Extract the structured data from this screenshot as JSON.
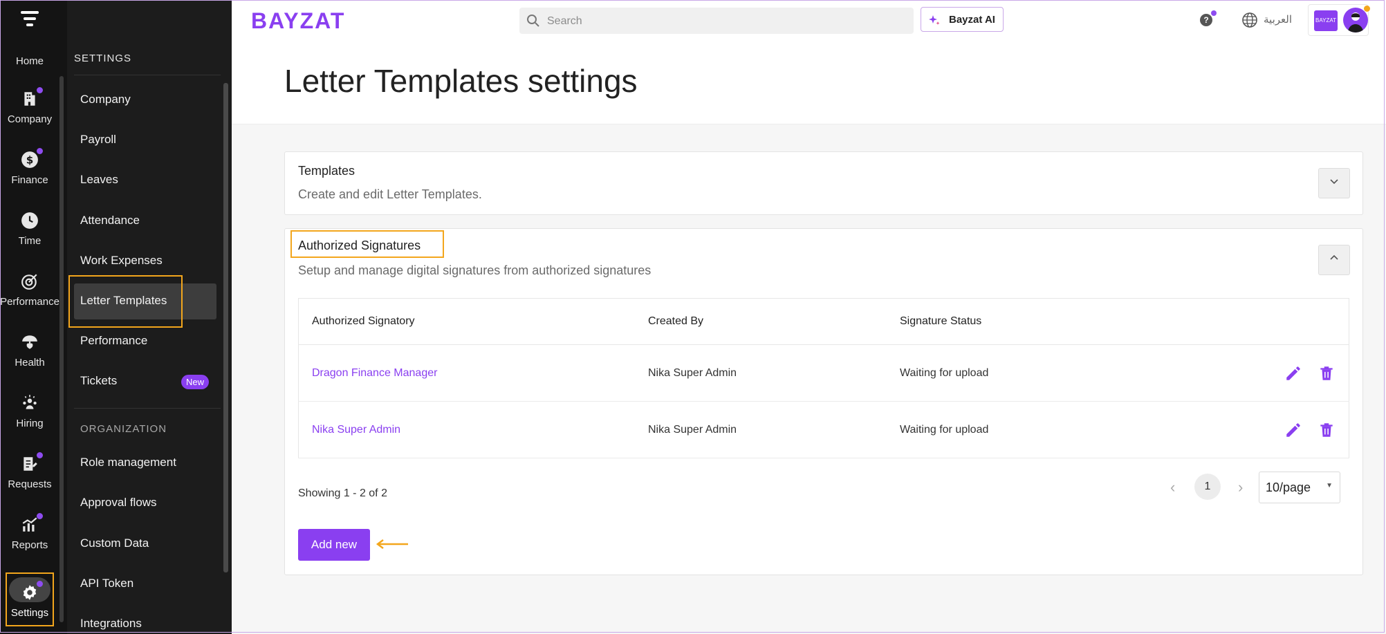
{
  "rail": {
    "items": [
      {
        "label": "Home",
        "icon": "home-icon"
      },
      {
        "label": "Company",
        "icon": "building-icon"
      },
      {
        "label": "Finance",
        "icon": "dollar-icon"
      },
      {
        "label": "Time",
        "icon": "clock-icon"
      },
      {
        "label": "Performance",
        "icon": "target-icon"
      },
      {
        "label": "Health",
        "icon": "umbrella-heart-icon"
      },
      {
        "label": "Hiring",
        "icon": "people-icon"
      },
      {
        "label": "Requests",
        "icon": "request-doc-icon"
      },
      {
        "label": "Reports",
        "icon": "chart-icon"
      },
      {
        "label": "Settings",
        "icon": "gear-icon"
      }
    ]
  },
  "menu": {
    "section_settings": "SETTINGS",
    "items": [
      "Company",
      "Payroll",
      "Leaves",
      "Attendance",
      "Work Expenses",
      "Letter Templates",
      "Performance",
      "Tickets"
    ],
    "new_badge": "New",
    "section_org": "ORGANIZATION",
    "org_items": [
      "Role management",
      "Approval flows",
      "Custom Data",
      "API Token",
      "Integrations"
    ]
  },
  "topbar": {
    "logo": "BAYZAT",
    "search_placeholder": "Search",
    "ai_button": "Bayzat AI",
    "help": "?",
    "language": "العربية",
    "company_logo_text": "BAYZAT"
  },
  "page": {
    "title": "Letter Templates settings"
  },
  "templates_card": {
    "title": "Templates",
    "description": "Create and edit Letter Templates."
  },
  "signatures_card": {
    "title": "Authorized Signatures",
    "description": "Setup and manage digital signatures from authorized signatures",
    "columns": [
      "Authorized Signatory",
      "Created By",
      "Signature Status"
    ],
    "rows": [
      {
        "signatory": "Dragon Finance Manager",
        "created_by": "Nika Super Admin",
        "status": "Waiting for upload"
      },
      {
        "signatory": "Nika Super Admin",
        "created_by": "Nika Super Admin",
        "status": "Waiting for upload"
      }
    ],
    "showing": "Showing 1 - 2 of 2",
    "current_page": "1",
    "page_size": "10/page",
    "add_button": "Add new"
  },
  "colors": {
    "accent": "#8a3ff0",
    "highlight": "#f3a61c",
    "sidebar_bg": "#141414"
  }
}
